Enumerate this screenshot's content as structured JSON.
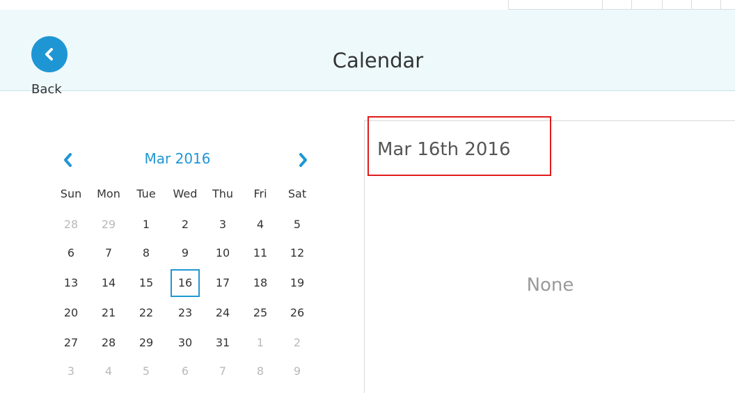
{
  "header": {
    "title": "Calendar",
    "back_label": "Back"
  },
  "calendar": {
    "month_label": "Mar 2016",
    "weekdays": [
      "Sun",
      "Mon",
      "Tue",
      "Wed",
      "Thu",
      "Fri",
      "Sat"
    ],
    "weeks": [
      [
        "28",
        "29",
        "1",
        "2",
        "3",
        "4",
        "5"
      ],
      [
        "6",
        "7",
        "8",
        "9",
        "10",
        "11",
        "12"
      ],
      [
        "13",
        "14",
        "15",
        "16",
        "17",
        "18",
        "19"
      ],
      [
        "20",
        "21",
        "22",
        "23",
        "24",
        "25",
        "26"
      ],
      [
        "27",
        "28",
        "29",
        "30",
        "31",
        "1",
        "2"
      ],
      [
        "3",
        "4",
        "5",
        "6",
        "7",
        "8",
        "9"
      ]
    ],
    "selected_day": "16"
  },
  "event_panel": {
    "date_heading": "Mar 16th 2016",
    "empty_text": "None"
  },
  "colors": {
    "accent": "#1f96d4",
    "header_bg": "#eef9fc",
    "highlight": "#e11b1b"
  }
}
